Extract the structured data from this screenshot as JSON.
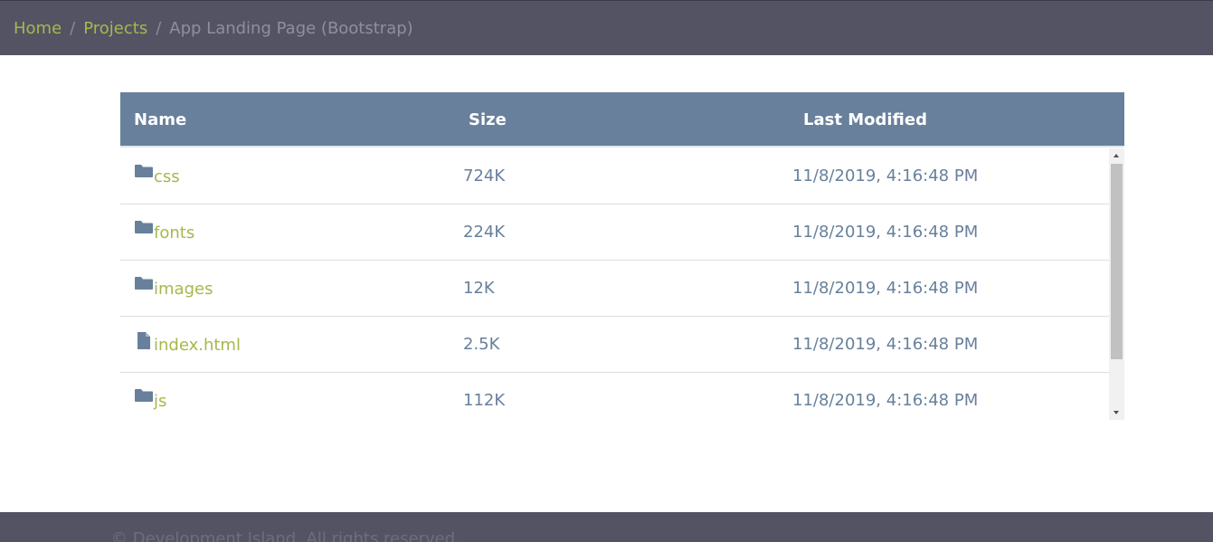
{
  "breadcrumb": {
    "home": "Home",
    "projects": "Projects",
    "separator": "/",
    "current": "App Landing Page (Bootstrap)"
  },
  "table": {
    "headers": {
      "name": "Name",
      "size": "Size",
      "modified": "Last Modified"
    },
    "rows": [
      {
        "icon": "folder-icon",
        "name": "css",
        "size": "724K",
        "modified": "11/8/2019, 4:16:48 PM"
      },
      {
        "icon": "folder-icon",
        "name": "fonts",
        "size": "224K",
        "modified": "11/8/2019, 4:16:48 PM"
      },
      {
        "icon": "folder-icon",
        "name": "images",
        "size": "12K",
        "modified": "11/8/2019, 4:16:48 PM"
      },
      {
        "icon": "file-icon",
        "name": "index.html",
        "size": "2.5K",
        "modified": "11/8/2019, 4:16:48 PM"
      },
      {
        "icon": "folder-icon",
        "name": "js",
        "size": "112K",
        "modified": "11/8/2019, 4:16:48 PM"
      }
    ]
  },
  "footer": {
    "text": "© Development Island. All rights reserved."
  },
  "colors": {
    "nav_bg": "#545364",
    "link": "#a4b94a",
    "header_bg": "#68809b",
    "text_muted": "#68809b"
  }
}
